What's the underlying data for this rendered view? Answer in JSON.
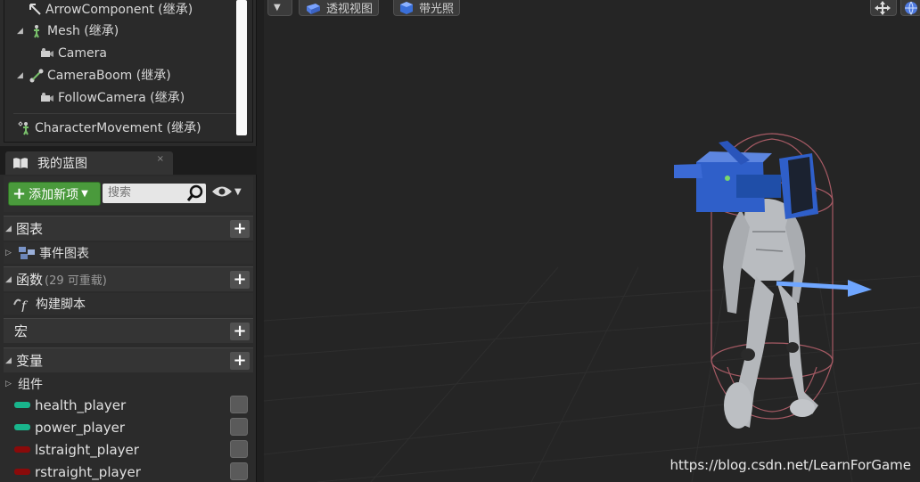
{
  "components": [
    {
      "label": "ArrowComponent (继承)",
      "icon": "arrow-component-icon"
    },
    {
      "label": "Mesh (继承)",
      "icon": "skeletal-mesh-icon"
    },
    {
      "label": "Camera",
      "icon": "camera-icon"
    },
    {
      "label": "CameraBoom (继承)",
      "icon": "spring-arm-icon"
    },
    {
      "label": "FollowCamera (继承)",
      "icon": "camera-icon"
    },
    {
      "label": "CharacterMovement (继承)",
      "icon": "character-movement-icon"
    }
  ],
  "my_blueprint": {
    "tab_label": "我的蓝图",
    "tab_close": "×",
    "add_new_label": "添加新项",
    "search_placeholder": "搜索",
    "sections": {
      "graphs": {
        "label": "图表",
        "child": "事件图表"
      },
      "functions": {
        "label": "函数",
        "note": "(29 可重载)",
        "child": "构建脚本"
      },
      "macros": {
        "label": "宏"
      },
      "variables": {
        "label": "变量",
        "group": "组件"
      }
    },
    "variables": [
      {
        "name": "health_player",
        "color": "#19b58c"
      },
      {
        "name": "power_player",
        "color": "#19b58c"
      },
      {
        "name": "lstraight_player",
        "color": "#8a0a0a"
      },
      {
        "name": "rstraight_player",
        "color": "#8a0a0a"
      }
    ]
  },
  "viewport": {
    "perspective_label": "透视视图",
    "lit_label": "带光照",
    "watermark": "https://blog.csdn.net/LearnForGame"
  },
  "colors": {
    "accent_green": "#4a9a3c",
    "camera_blue": "#2f5fc9",
    "capsule": "#a65a64",
    "arrow": "#6fa6ff"
  }
}
